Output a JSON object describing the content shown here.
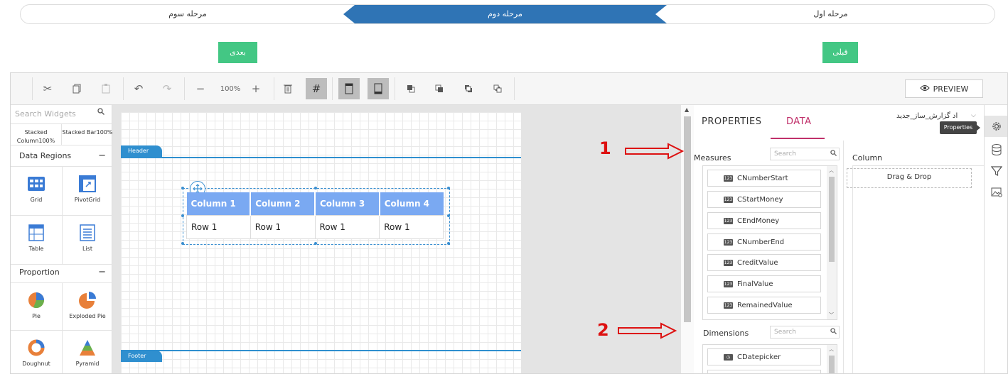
{
  "wizard": {
    "steps": [
      "مرحله سوم",
      "مرحله دوم",
      "مرحله اول"
    ],
    "active_step": "مرحله دوم"
  },
  "nav": {
    "next_label": "بعدی",
    "prev_label": "قبلی"
  },
  "toolbar": {
    "zoom_value": "100%",
    "preview_label": "PREVIEW"
  },
  "widgets": {
    "search_placeholder": "Search Widgets",
    "top_items": [
      "Stacked Column100%",
      "Stacked Bar100%"
    ],
    "sections": [
      {
        "title": "Data Regions",
        "items": [
          "Grid",
          "PivotGrid",
          "Table",
          "List"
        ]
      },
      {
        "title": "Proportion",
        "items": [
          "Pie",
          "Exploded Pie",
          "Doughnut",
          "Pyramid"
        ]
      }
    ]
  },
  "canvas": {
    "header_label": "Header",
    "footer_label": "Footer",
    "table": {
      "columns": [
        "Column 1",
        "Column 2",
        "Column 3",
        "Column 4"
      ],
      "rows": [
        [
          "Row 1",
          "Row 1",
          "Row 1",
          "Row 1"
        ]
      ]
    }
  },
  "properties": {
    "tabs": [
      "PROPERTIES",
      "DATA"
    ],
    "active_tab": "DATA",
    "dataset_name": "اد گزارش_ساز_جدید",
    "measures_title": "Measures",
    "measures_search": "Search",
    "measures": [
      "CNumberStart",
      "CStartMoney",
      "CEndMoney",
      "CNumberEnd",
      "CreditValue",
      "FinalValue",
      "RemainedValue"
    ],
    "dimensions_title": "Dimensions",
    "dimensions_search": "Search",
    "dimensions": [
      "CDatepicker"
    ],
    "column_title": "Column",
    "drop_label": "Drag & Drop",
    "tooltip": "Properties"
  },
  "annotations": {
    "arrow1": "1",
    "arrow2": "2",
    "color": "#dd1111"
  },
  "colors": {
    "accent": "#2f74b5",
    "green": "#43c784",
    "band": "#2f8fcf",
    "table_header": "#7aa9f2",
    "data_tab": "#c0306a"
  }
}
